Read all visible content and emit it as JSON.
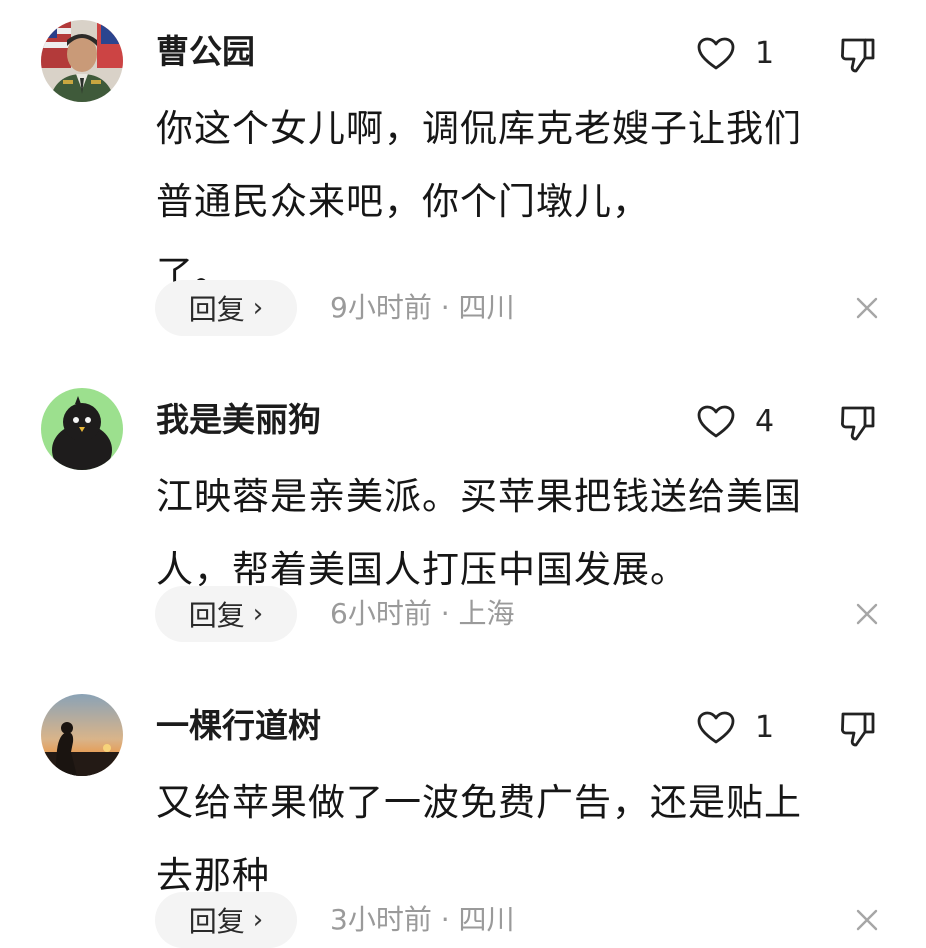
{
  "comments": [
    {
      "username": "曹公园",
      "likes": "1",
      "content": "你这个女儿啊，调侃库克老嫂子让我们\n普通民众来吧，你个门墩儿，\n了。",
      "reply_label": "回复",
      "time": "9小时前",
      "separator": "·",
      "location": "四川"
    },
    {
      "username": "我是美丽狗",
      "likes": "4",
      "content": "江映蓉是亲美派。买苹果把钱送给美国\n人，帮着美国人打压中国发展。",
      "reply_label": "回复",
      "time": "6小时前",
      "separator": "·",
      "location": "上海"
    },
    {
      "username": "一棵行道树",
      "likes": "1",
      "content": "又给苹果做了一波免费广告，还是贴上\n去那种",
      "reply_label": "回复",
      "time": "3小时前",
      "separator": "·",
      "location": "四川"
    }
  ],
  "icons": {
    "like": "heart-outline-icon",
    "dislike": "thumbs-down-icon",
    "reply_arrow": "chevron-right-icon",
    "close": "close-x-icon"
  },
  "colors": {
    "text": "#161616",
    "meta": "#9a9a9a",
    "reply_bg": "#f4f4f4",
    "avatar2_bg": "#9ce08e"
  }
}
